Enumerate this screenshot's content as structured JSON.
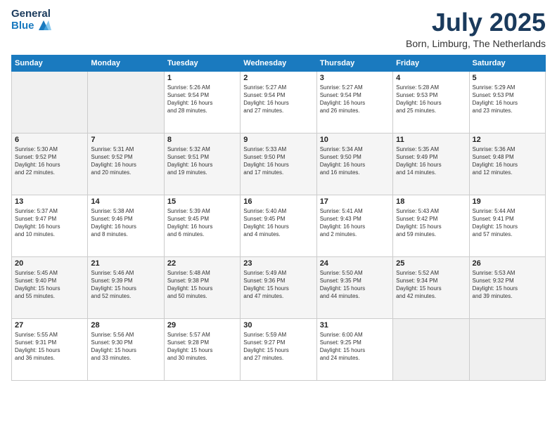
{
  "header": {
    "logo_general": "General",
    "logo_blue": "Blue",
    "month": "July 2025",
    "location": "Born, Limburg, The Netherlands"
  },
  "weekdays": [
    "Sunday",
    "Monday",
    "Tuesday",
    "Wednesday",
    "Thursday",
    "Friday",
    "Saturday"
  ],
  "weeks": [
    [
      {
        "day": "",
        "info": ""
      },
      {
        "day": "",
        "info": ""
      },
      {
        "day": "1",
        "info": "Sunrise: 5:26 AM\nSunset: 9:54 PM\nDaylight: 16 hours\nand 28 minutes."
      },
      {
        "day": "2",
        "info": "Sunrise: 5:27 AM\nSunset: 9:54 PM\nDaylight: 16 hours\nand 27 minutes."
      },
      {
        "day": "3",
        "info": "Sunrise: 5:27 AM\nSunset: 9:54 PM\nDaylight: 16 hours\nand 26 minutes."
      },
      {
        "day": "4",
        "info": "Sunrise: 5:28 AM\nSunset: 9:53 PM\nDaylight: 16 hours\nand 25 minutes."
      },
      {
        "day": "5",
        "info": "Sunrise: 5:29 AM\nSunset: 9:53 PM\nDaylight: 16 hours\nand 23 minutes."
      }
    ],
    [
      {
        "day": "6",
        "info": "Sunrise: 5:30 AM\nSunset: 9:52 PM\nDaylight: 16 hours\nand 22 minutes."
      },
      {
        "day": "7",
        "info": "Sunrise: 5:31 AM\nSunset: 9:52 PM\nDaylight: 16 hours\nand 20 minutes."
      },
      {
        "day": "8",
        "info": "Sunrise: 5:32 AM\nSunset: 9:51 PM\nDaylight: 16 hours\nand 19 minutes."
      },
      {
        "day": "9",
        "info": "Sunrise: 5:33 AM\nSunset: 9:50 PM\nDaylight: 16 hours\nand 17 minutes."
      },
      {
        "day": "10",
        "info": "Sunrise: 5:34 AM\nSunset: 9:50 PM\nDaylight: 16 hours\nand 16 minutes."
      },
      {
        "day": "11",
        "info": "Sunrise: 5:35 AM\nSunset: 9:49 PM\nDaylight: 16 hours\nand 14 minutes."
      },
      {
        "day": "12",
        "info": "Sunrise: 5:36 AM\nSunset: 9:48 PM\nDaylight: 16 hours\nand 12 minutes."
      }
    ],
    [
      {
        "day": "13",
        "info": "Sunrise: 5:37 AM\nSunset: 9:47 PM\nDaylight: 16 hours\nand 10 minutes."
      },
      {
        "day": "14",
        "info": "Sunrise: 5:38 AM\nSunset: 9:46 PM\nDaylight: 16 hours\nand 8 minutes."
      },
      {
        "day": "15",
        "info": "Sunrise: 5:39 AM\nSunset: 9:45 PM\nDaylight: 16 hours\nand 6 minutes."
      },
      {
        "day": "16",
        "info": "Sunrise: 5:40 AM\nSunset: 9:45 PM\nDaylight: 16 hours\nand 4 minutes."
      },
      {
        "day": "17",
        "info": "Sunrise: 5:41 AM\nSunset: 9:43 PM\nDaylight: 16 hours\nand 2 minutes."
      },
      {
        "day": "18",
        "info": "Sunrise: 5:43 AM\nSunset: 9:42 PM\nDaylight: 15 hours\nand 59 minutes."
      },
      {
        "day": "19",
        "info": "Sunrise: 5:44 AM\nSunset: 9:41 PM\nDaylight: 15 hours\nand 57 minutes."
      }
    ],
    [
      {
        "day": "20",
        "info": "Sunrise: 5:45 AM\nSunset: 9:40 PM\nDaylight: 15 hours\nand 55 minutes."
      },
      {
        "day": "21",
        "info": "Sunrise: 5:46 AM\nSunset: 9:39 PM\nDaylight: 15 hours\nand 52 minutes."
      },
      {
        "day": "22",
        "info": "Sunrise: 5:48 AM\nSunset: 9:38 PM\nDaylight: 15 hours\nand 50 minutes."
      },
      {
        "day": "23",
        "info": "Sunrise: 5:49 AM\nSunset: 9:36 PM\nDaylight: 15 hours\nand 47 minutes."
      },
      {
        "day": "24",
        "info": "Sunrise: 5:50 AM\nSunset: 9:35 PM\nDaylight: 15 hours\nand 44 minutes."
      },
      {
        "day": "25",
        "info": "Sunrise: 5:52 AM\nSunset: 9:34 PM\nDaylight: 15 hours\nand 42 minutes."
      },
      {
        "day": "26",
        "info": "Sunrise: 5:53 AM\nSunset: 9:32 PM\nDaylight: 15 hours\nand 39 minutes."
      }
    ],
    [
      {
        "day": "27",
        "info": "Sunrise: 5:55 AM\nSunset: 9:31 PM\nDaylight: 15 hours\nand 36 minutes."
      },
      {
        "day": "28",
        "info": "Sunrise: 5:56 AM\nSunset: 9:30 PM\nDaylight: 15 hours\nand 33 minutes."
      },
      {
        "day": "29",
        "info": "Sunrise: 5:57 AM\nSunset: 9:28 PM\nDaylight: 15 hours\nand 30 minutes."
      },
      {
        "day": "30",
        "info": "Sunrise: 5:59 AM\nSunset: 9:27 PM\nDaylight: 15 hours\nand 27 minutes."
      },
      {
        "day": "31",
        "info": "Sunrise: 6:00 AM\nSunset: 9:25 PM\nDaylight: 15 hours\nand 24 minutes."
      },
      {
        "day": "",
        "info": ""
      },
      {
        "day": "",
        "info": ""
      }
    ]
  ]
}
